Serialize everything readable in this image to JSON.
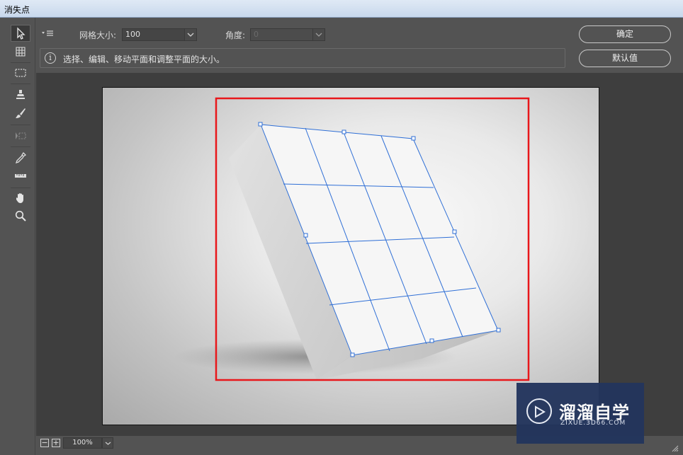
{
  "window": {
    "title": "消失点"
  },
  "options": {
    "grid_size_label": "网格大小:",
    "grid_size_value": "100",
    "angle_label": "角度:",
    "angle_value": "0",
    "info_text": "选择、编辑、移动平面和调整平面的大小。",
    "info_icon": "info-icon",
    "ok_label": "确定",
    "default_label": "默认值"
  },
  "toolbar": {
    "tools": [
      "edit-plane-icon",
      "create-plane-icon",
      "marquee-icon",
      "stamp-icon",
      "brush-icon",
      "transform-icon",
      "eyedropper-icon",
      "measure-icon",
      "hand-icon",
      "zoom-icon"
    ],
    "active": "edit-plane-icon"
  },
  "statusbar": {
    "zoom": "100%"
  },
  "watermark": {
    "brand": "溜溜自学",
    "url": "ZIXUE.3D66.COM"
  },
  "colors": {
    "selection": "#e8171b",
    "grid": "#2f6fd6",
    "panel": "#535353",
    "workarea": "#3e3e3e"
  }
}
